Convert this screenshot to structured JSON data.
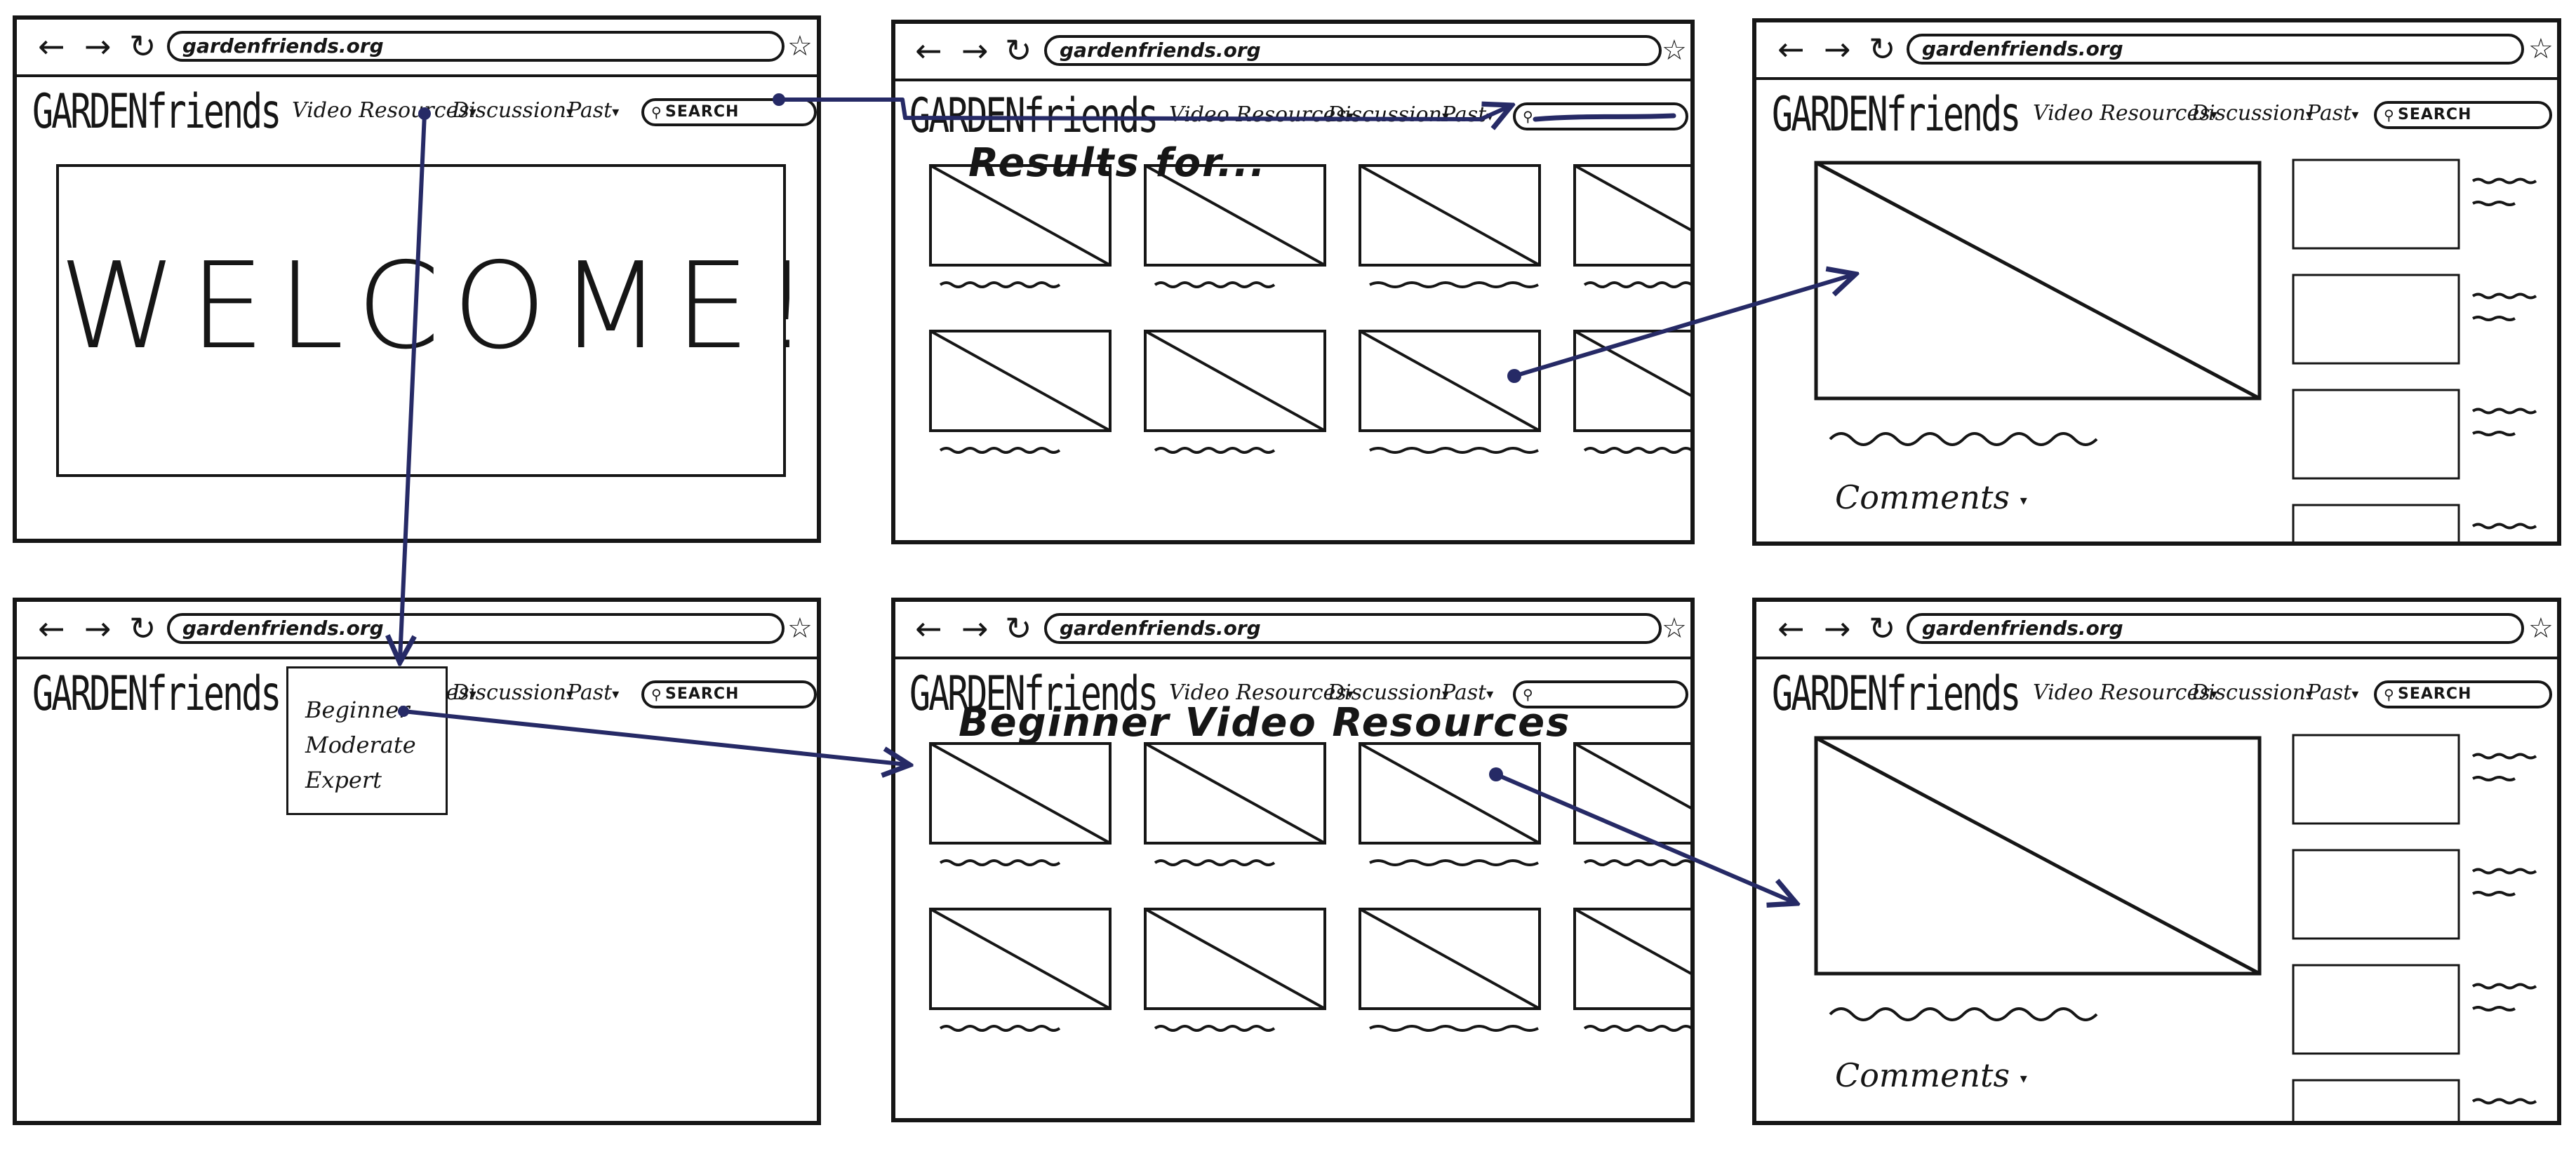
{
  "browser": {
    "url": "gardenfriends.org",
    "back_glyph": "←",
    "forward_glyph": "→",
    "reload_glyph": "↻",
    "star_glyph": "☆"
  },
  "site": {
    "logo": "GARDENfriends",
    "nav": {
      "video_resources": "Video Resources",
      "discussion": "Discussion",
      "past": "Past",
      "caret": "▾"
    },
    "search_label": "SEARCH",
    "search_glyph": "⚲"
  },
  "home": {
    "welcome": "WELCOME!"
  },
  "dropdown": {
    "items": [
      "Beginner",
      "Moderate",
      "Expert"
    ]
  },
  "search_results": {
    "heading": "Results for..."
  },
  "category": {
    "heading": "Beginner Video Resources"
  },
  "video_page": {
    "comments_label": "Comments",
    "caret": "▾"
  },
  "colors": {
    "ink": "#161616",
    "flow_arrow": "#262a66"
  }
}
